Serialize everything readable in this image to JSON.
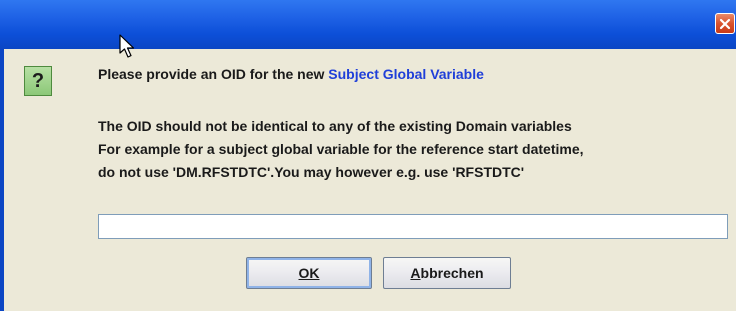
{
  "dialog": {
    "close_icon": "close-x",
    "question_icon_glyph": "?",
    "message": {
      "line1_prefix": "Please provide an OID for the new ",
      "line1_highlight": "Subject Global Variable",
      "line2": "The OID should not be identical to any of the existing Domain variables",
      "line3": "For example for a subject global variable for the reference start datetime,",
      "line4": "do not use 'DM.RFSTDTC'.You may however e.g. use 'RFSTDTC'"
    },
    "input": {
      "value": "",
      "placeholder": ""
    },
    "buttons": {
      "ok_label": "OK",
      "cancel_mnemonic": "A",
      "cancel_rest": "bbrechen"
    }
  },
  "colors": {
    "titlebar": "#0b46c4",
    "highlight_text": "#1f3fd9",
    "background": "#ece9d8",
    "close_button": "#d9532e",
    "question_icon": "#8cc878"
  }
}
